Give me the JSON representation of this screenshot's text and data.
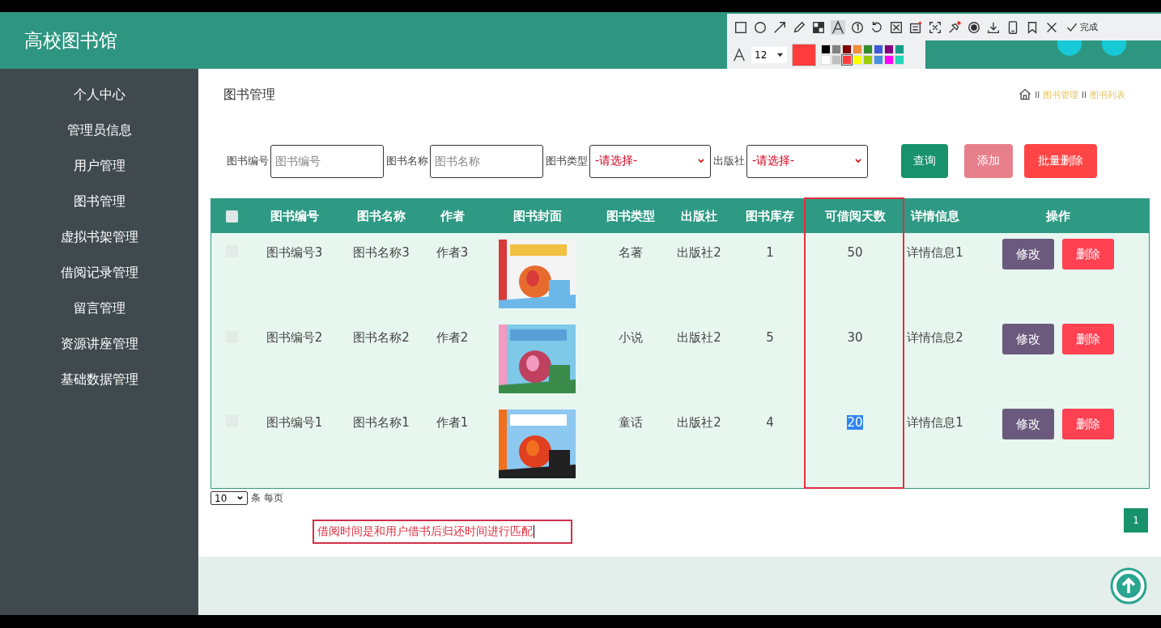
{
  "app_title": "高校图书馆",
  "annotation_toolbar": {
    "tools": [
      {
        "kind": "rect",
        "selected": false
      },
      {
        "kind": "ellipse",
        "selected": false
      },
      {
        "kind": "arrow",
        "selected": false
      },
      {
        "kind": "pencil",
        "selected": false
      },
      {
        "kind": "mosaic",
        "selected": false
      },
      {
        "kind": "text",
        "selected": true
      },
      {
        "kind": "number",
        "selected": false
      },
      {
        "kind": "undo",
        "selected": false
      },
      {
        "kind": "cut",
        "selected": false
      },
      {
        "kind": "ocr",
        "selected": false
      },
      {
        "kind": "crop",
        "selected": false
      },
      {
        "kind": "pin",
        "selected": false
      },
      {
        "kind": "record",
        "selected": false
      },
      {
        "kind": "save",
        "selected": false
      },
      {
        "kind": "phone",
        "selected": false
      },
      {
        "kind": "bookmark",
        "selected": false
      },
      {
        "kind": "close",
        "selected": false
      }
    ],
    "done_label": "完成",
    "size_choice": "12",
    "swatches": [
      {
        "color": "#000000",
        "selected": false
      },
      {
        "color": "#808080",
        "selected": false
      },
      {
        "color": "#800000",
        "selected": false
      },
      {
        "color": "#f28c38",
        "selected": false
      },
      {
        "color": "#2e8b2e",
        "selected": false
      },
      {
        "color": "#3b5bdb",
        "selected": false
      },
      {
        "color": "#800080",
        "selected": false
      },
      {
        "color": "#169c8a",
        "selected": false
      },
      {
        "color": "#ffffff",
        "selected": false
      },
      {
        "color": "#c0c0c0",
        "selected": false
      },
      {
        "color": "#ff3b3b",
        "selected": true
      },
      {
        "color": "#ffff00",
        "selected": false
      },
      {
        "color": "#99cc00",
        "selected": false
      },
      {
        "color": "#4a90e2",
        "selected": false
      },
      {
        "color": "#ff00ff",
        "selected": false
      },
      {
        "color": "#20d6b8",
        "selected": false
      }
    ]
  },
  "sidebar": {
    "items": [
      {
        "label": "个人中心"
      },
      {
        "label": "管理员信息"
      },
      {
        "label": "用户管理"
      },
      {
        "label": "图书管理"
      },
      {
        "label": "虚拟书架管理"
      },
      {
        "label": "借阅记录管理"
      },
      {
        "label": "留言管理"
      },
      {
        "label": "资源讲座管理"
      },
      {
        "label": "基础数据管理"
      }
    ]
  },
  "page_title": "图书管理",
  "breadcrumb": [
    {
      "separator": "II",
      "label": "图书管理"
    },
    {
      "separator": "II",
      "label": "图书列表"
    }
  ],
  "filters": [
    {
      "kind": "input",
      "label": "图书编号",
      "placeholder": "图书编号"
    },
    {
      "kind": "input",
      "label": "图书名称",
      "placeholder": "图书名称"
    },
    {
      "kind": "select",
      "label": "图书类型",
      "value": "-请选择-"
    },
    {
      "kind": "select",
      "label": "出版社",
      "value": "-请选择-"
    }
  ],
  "actions": [
    {
      "kind": "search",
      "label": "查询"
    },
    {
      "kind": "add",
      "label": "添加"
    },
    {
      "kind": "delete",
      "label": "批量删除"
    }
  ],
  "table": {
    "select_all_checked": false,
    "columns": [
      "图书编号",
      "图书名称",
      "作者",
      "图书封面",
      "图书类型",
      "出版社",
      "图书库存",
      "可借阅天数",
      "详情信息",
      "操作"
    ],
    "rows": [
      {
        "checked": false,
        "id": "图书编号3",
        "name": "图书名称3",
        "author": "作者3",
        "type": "名著",
        "publisher": "出版社2",
        "stock": "1",
        "days": "50",
        "days_selected": false,
        "details": "详情信息1",
        "edit": "修改",
        "delete": "删除"
      },
      {
        "checked": false,
        "id": "图书编号2",
        "name": "图书名称2",
        "author": "作者2",
        "type": "小说",
        "publisher": "出版社2",
        "stock": "5",
        "days": "30",
        "days_selected": false,
        "details": "详情信息2",
        "edit": "修改",
        "delete": "删除"
      },
      {
        "checked": false,
        "id": "图书编号1",
        "name": "图书名称1",
        "author": "作者1",
        "type": "童话",
        "publisher": "出版社2",
        "stock": "4",
        "days": "20",
        "days_selected": true,
        "details": "详情信息1",
        "edit": "修改",
        "delete": "删除"
      }
    ]
  },
  "pager": {
    "page_size": "10",
    "page_size_label": "条 每页",
    "pages": [
      {
        "label": "1",
        "selected": true
      }
    ]
  },
  "note": "借阅时间是和用户借书后归还时间进行匹配"
}
